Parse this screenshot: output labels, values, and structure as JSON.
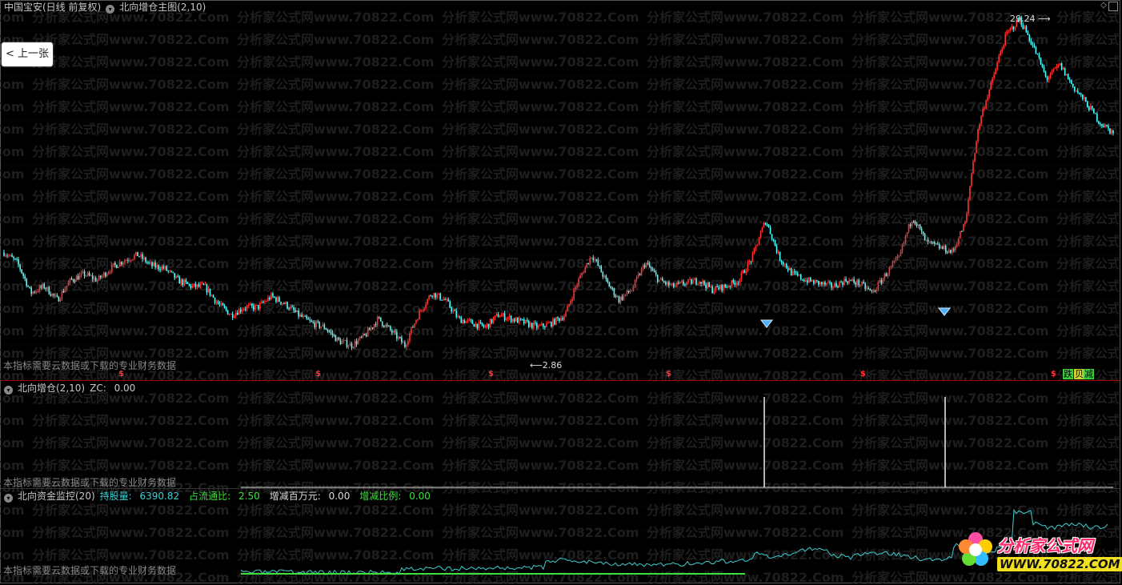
{
  "main_panel": {
    "stock_title": "中国宝安(日线 前复权)",
    "indicator_title": "北向增仓主图(2,10)",
    "high_label": "29.24",
    "low_label": "2.86",
    "note": "本指标需要云数据或下载的专业财务数据",
    "badge_die": "跌",
    "badge_jian": "减",
    "buy_marker": "$",
    "prev_button": "上一张"
  },
  "panel2": {
    "title": "北向增仓(2,10)",
    "zc_label": "ZC:",
    "zc_value": "0.00",
    "note": "本指标需要云数据或下载的专业财务数据"
  },
  "panel3": {
    "title": "北向资金监控(20)",
    "hold_label": "持股量:",
    "hold_value": "6390.82",
    "ratio_label": "占流通比:",
    "ratio_value": "2.50",
    "change_label": "增减百万元:",
    "change_value": "0.00",
    "change_ratio_label": "增减比例:",
    "change_ratio_value": "0.00",
    "note": "本指标需要云数据或下载的专业财务数据"
  },
  "watermark": "分析家公式网www.70822.Com",
  "logo": {
    "name": "分析家公式网",
    "url": "WWW.70822.COM"
  },
  "colors": {
    "up": "#ff3232",
    "down": "#54fcfc",
    "grid": "#5a0000",
    "label_cyan": "#3ecfcf",
    "label_green": "#3ee03e"
  },
  "chart_data": [
    {
      "type": "candlestick",
      "title": "北向增仓主图(2,10)",
      "y_annotations": {
        "high": 29.24,
        "low": 2.86
      },
      "ylim": [
        2.5,
        30
      ],
      "trend": [
        5.6,
        5.2,
        4.2,
        4.4,
        4.0,
        4.6,
        4.8,
        4.6,
        5.0,
        5.3,
        5.5,
        5.1,
        5.0,
        4.6,
        4.4,
        4.4,
        3.9,
        3.6,
        3.8,
        3.8,
        4.1,
        3.9,
        3.6,
        3.4,
        3.3,
        3.0,
        2.9,
        3.1,
        3.5,
        3.2,
        2.9,
        3.6,
        4.2,
        4.0,
        3.5,
        3.4,
        3.3,
        3.6,
        3.5,
        3.4,
        3.3,
        3.4,
        3.6,
        4.6,
        5.5,
        4.6,
        4.0,
        4.3,
        5.2,
        4.6,
        4.4,
        4.5,
        4.6,
        4.3,
        4.4,
        4.6,
        5.4,
        7.0,
        5.4,
        4.8,
        4.6,
        4.5,
        4.4,
        4.6,
        4.5,
        4.2,
        4.8,
        5.4,
        7.2,
        6.0,
        5.8,
        5.6,
        7.0,
        14,
        19,
        26,
        29,
        24,
        19,
        21,
        18,
        16,
        14,
        13
      ]
    },
    {
      "type": "bar",
      "title": "北向增仓(2,10)",
      "spikes": [
        {
          "index": 954,
          "value": 1
        },
        {
          "index": 1180,
          "value": 1
        }
      ]
    },
    {
      "type": "line",
      "title": "北向资金监控(20)",
      "series": [
        {
          "name": "持股量",
          "last": 6390.82
        }
      ]
    }
  ]
}
